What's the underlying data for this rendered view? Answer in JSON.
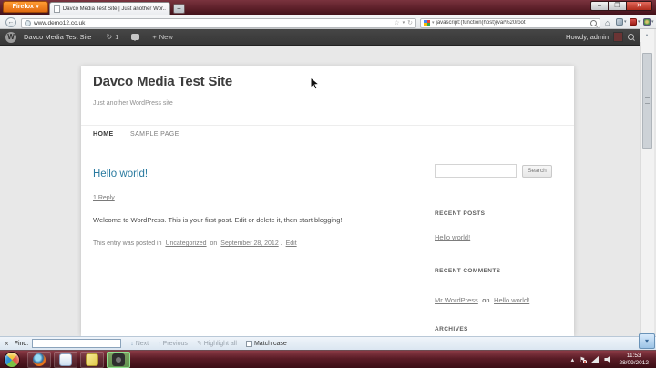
{
  "glyphs": {
    "caret_down": "▾",
    "star": "☆",
    "reload": "↻",
    "back": "←",
    "home": "⌂",
    "plus": "+",
    "minimize": "–",
    "maximize": "❐",
    "close": "✕",
    "close_x": "×",
    "up_arrow": "↑",
    "down_arrow": "↓",
    "small_up": "▴",
    "small_down": "▾",
    "flag": "⚑",
    "pencil": "✎",
    "w_logo": "W",
    "magnifier": "search"
  },
  "titlebar": {
    "firefox_button": "Firefox",
    "tab_title": "Davco Media Test Site | Just another Wor...",
    "new_tab": "+"
  },
  "navbar": {
    "url": "www.demo12.co.uk",
    "search_value": "javascript:(function(host){var%20root"
  },
  "admin_bar": {
    "site_name": "Davco Media Test Site",
    "update_count": "1",
    "new_label": "New",
    "howdy": "Howdy, admin"
  },
  "page": {
    "site_title": "Davco Media Test Site",
    "tagline": "Just another WordPress site",
    "nav_home": "HOME",
    "nav_sample": "SAMPLE PAGE",
    "post": {
      "title": "Hello world!",
      "reply": "1 Reply",
      "body": "Welcome to WordPress. This is your first post. Edit or delete it, then start blogging!",
      "meta_prefix": "This entry was posted in",
      "meta_category": "Uncategorized",
      "meta_on": "on",
      "meta_date": "September 28, 2012",
      "meta_period": ".",
      "meta_edit": "Edit"
    },
    "sidebar": {
      "search_button": "Search",
      "recent_posts_heading": "RECENT POSTS",
      "recent_post_link": "Hello world!",
      "recent_comments_heading": "RECENT COMMENTS",
      "comment_author": "Mr WordPress",
      "comment_on": "on",
      "comment_post": "Hello world!",
      "archives_heading": "ARCHIVES"
    }
  },
  "findbar": {
    "label": "Find:",
    "next": "Next",
    "previous": "Previous",
    "highlight_all": "Highlight all",
    "match_case": "Match case"
  },
  "taskbar": {
    "time": "11:53",
    "date": "28/09/2012"
  },
  "colors": {
    "accent_maroon": "#5c1f29",
    "adminbar_dark": "#3c3c3c",
    "link_teal": "#2a7ba0",
    "firefox_orange": "#e06a10"
  }
}
